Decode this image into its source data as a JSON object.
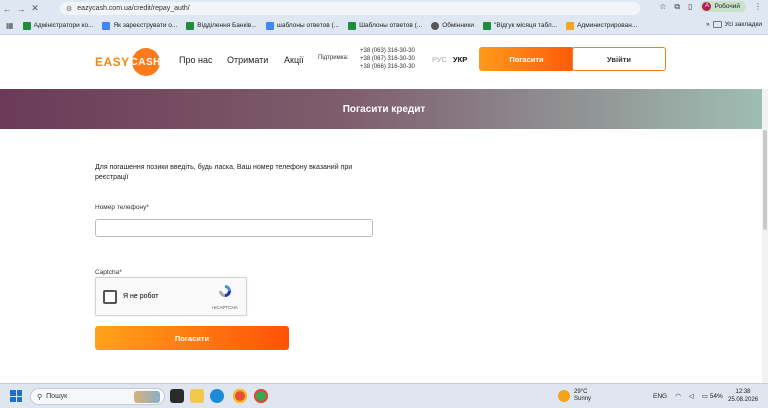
{
  "browser": {
    "url": "eazycash.com.ua/credit/repay_auth/",
    "profile_label": "Робочий",
    "profile_initial": "А",
    "bookmarks": [
      {
        "label": "Адміністратори ко...",
        "color": "#1e8e3e"
      },
      {
        "label": "Як зареєструвати о...",
        "color": "#4285f4"
      },
      {
        "label": "Відділення Банків...",
        "color": "#1e8e3e"
      },
      {
        "label": "шаблоны ответов (...",
        "color": "#4285f4"
      },
      {
        "label": "Шаблоны ответов (...",
        "color": "#1e8e3e"
      },
      {
        "label": "Обмінники",
        "color": "#555555"
      },
      {
        "label": "\"Відгук місяця табл...",
        "color": "#1e8e3e"
      },
      {
        "label": "Администрирован...",
        "color": "#f5a623"
      }
    ],
    "all_bookmarks_label": "Усі закладки"
  },
  "site": {
    "logo_left": "EASY",
    "logo_right": "CASH",
    "menu": [
      "Про нас",
      "Отримати",
      "Акції"
    ],
    "support_label": "Підтримка:",
    "phones": [
      "+38 (063) 316-30-30",
      "+38 (067) 316-30-30",
      "+38 (066) 316-30-30"
    ],
    "lang_ru": "РУС",
    "lang_ua": "УКР",
    "pay_button": "Погасити",
    "login_button": "Увійти",
    "banner_title": "Погасити кредит"
  },
  "form": {
    "intro": "Для погашення позики введіть, будь ласка, Ваш номер телефону вказаний при реєстрації",
    "phone_label": "Номер телефону*",
    "phone_value": "",
    "captcha_label": "Captcha*",
    "captcha_text": "Я не робот",
    "captcha_brand": "reCAPTCHA",
    "submit": "Погасити"
  },
  "taskbar": {
    "search_placeholder": "Пошук",
    "weather_temp": "29°C",
    "weather_desc": "Sunny",
    "lang": "ENG",
    "battery": "54%",
    "time": "12:38",
    "date": "25.08.2026"
  }
}
